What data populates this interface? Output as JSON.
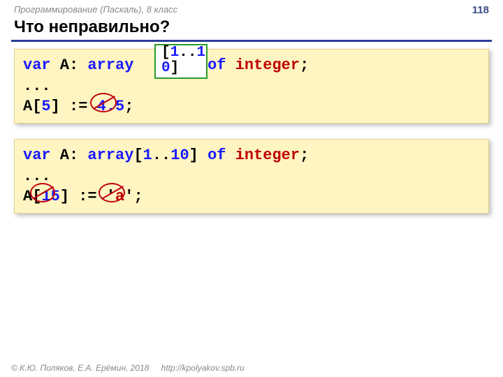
{
  "header": {
    "course": "Программирование (Паскаль), 8 класс",
    "page": "118"
  },
  "title": "Что неправильно?",
  "callout": {
    "open": "[",
    "numA": "1",
    "dots": "..",
    "numB1": "1",
    "numB2": "0",
    "close": "]"
  },
  "block1": {
    "l1": {
      "kw1": "var",
      "sp1": " A: ",
      "kw2": "array",
      "after_array": "        ",
      "kw3": "of",
      "sp2": " ",
      "typ": "integer",
      "semi": ";"
    },
    "l2": "...",
    "l3": {
      "a": "A[",
      "idx": "5",
      "b": "] := ",
      "val": "4.5",
      "semi": ";"
    }
  },
  "block2": {
    "l1": {
      "kw1": "var",
      "sp1": " A: ",
      "kw2": "array",
      "open": "[",
      "n1": "1",
      "dots": "..",
      "n2": "10",
      "close": "]",
      "sp2": " ",
      "kw3": "of",
      "sp3": " ",
      "typ": "integer",
      "semi": ";"
    },
    "l2": "...",
    "l3": {
      "a": "A[",
      "idx": "15",
      "b": "] := ",
      "q1": "'",
      "val": "a",
      "q2": "'",
      "semi": ";"
    }
  },
  "footer": {
    "copyright": "© К.Ю. Поляков, Е.А. Ерёмин, 2018",
    "url": "http://kpolyakov.spb.ru"
  }
}
